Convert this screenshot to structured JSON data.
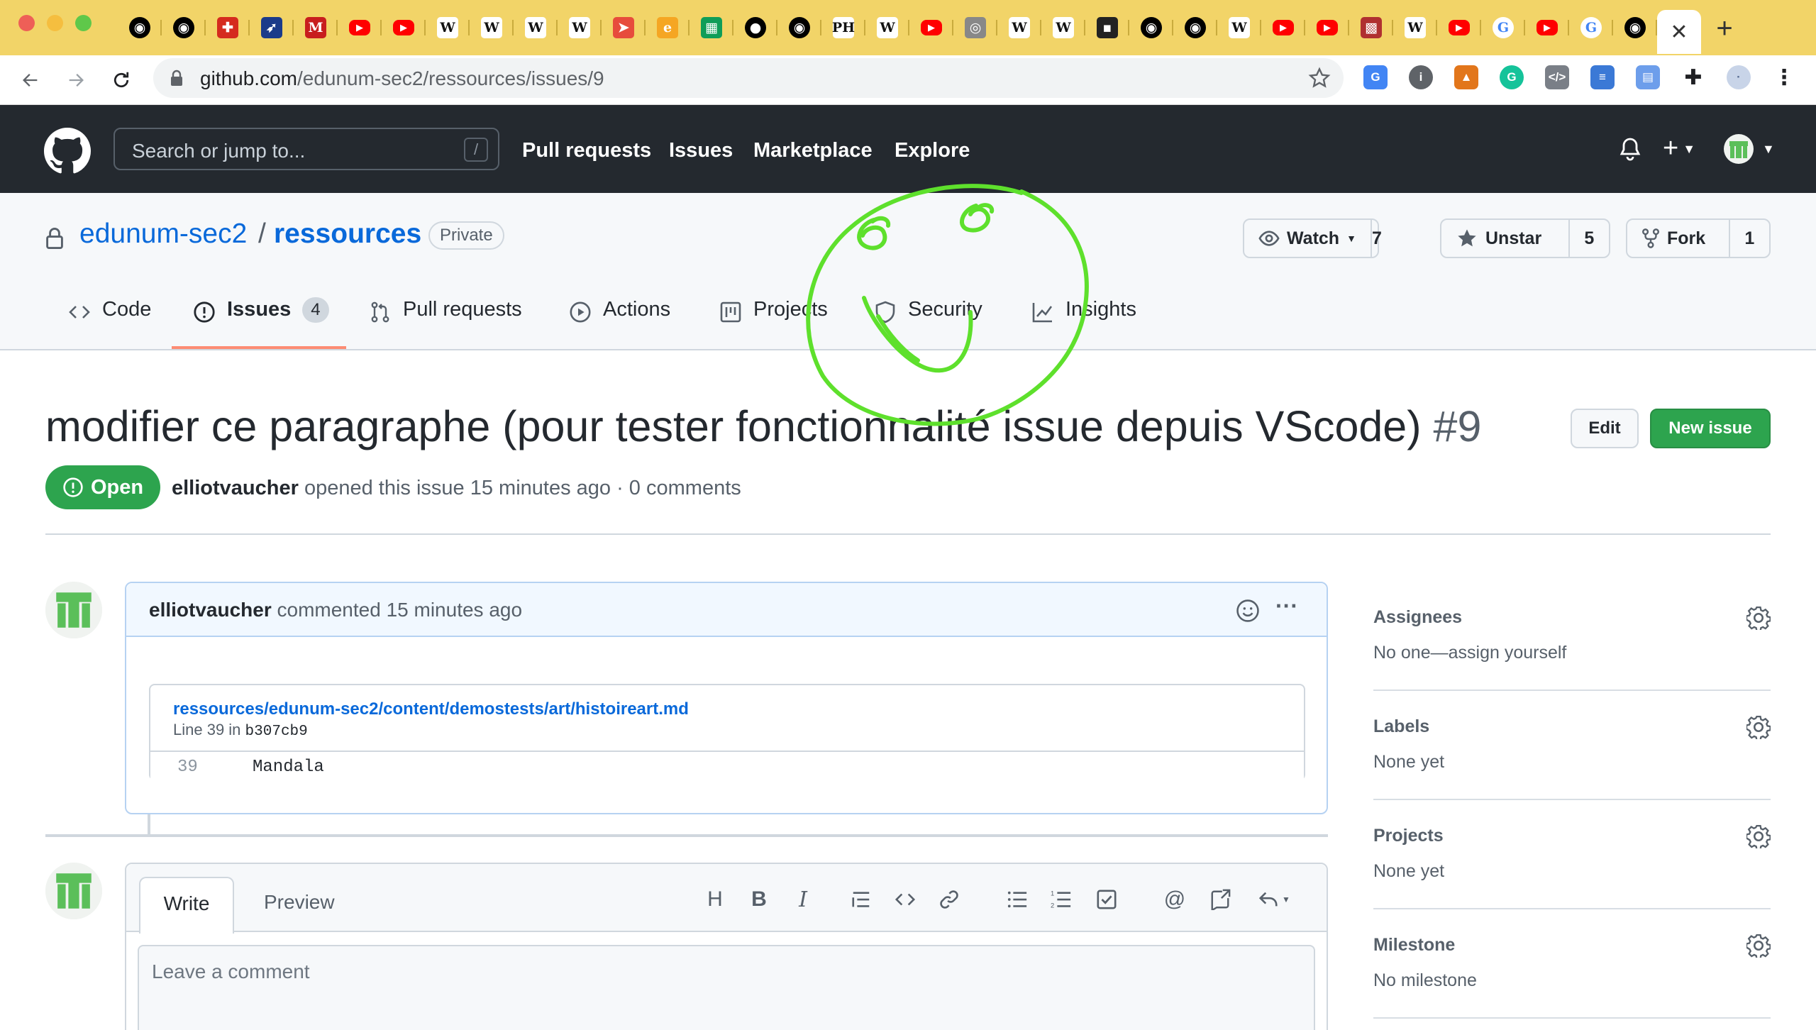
{
  "browser": {
    "url_host": "github.com",
    "url_path": "/edunum-sec2/ressources/issues/9",
    "tabs": [
      {
        "icon": "github-icon",
        "color": "#000"
      },
      {
        "icon": "github-icon",
        "color": "#000"
      },
      {
        "icon": "swiss-icon",
        "color": "#d52b1e"
      },
      {
        "icon": "plane-icon",
        "color": "#1b3b8a"
      },
      {
        "icon": "m-icon",
        "color": "#c81e1e"
      },
      {
        "icon": "youtube-icon",
        "color": "#ff0000"
      },
      {
        "icon": "youtube-icon",
        "color": "#ff0000"
      },
      {
        "icon": "wikipedia-icon",
        "color": "#fff"
      },
      {
        "icon": "wikipedia-icon",
        "color": "#fff"
      },
      {
        "icon": "wikipedia-icon",
        "color": "#fff"
      },
      {
        "icon": "wikipedia-icon",
        "color": "#fff"
      },
      {
        "icon": "arrow-icon",
        "color": "#e74c3c"
      },
      {
        "icon": "epfl-icon",
        "color": "#f5a623"
      },
      {
        "icon": "sheets-icon",
        "color": "#0f9d58"
      },
      {
        "icon": "dot-icon",
        "color": "#000"
      },
      {
        "icon": "github-icon",
        "color": "#000"
      },
      {
        "icon": "phzh-icon",
        "color": "#fff"
      },
      {
        "icon": "wikipedia-icon",
        "color": "#fff"
      },
      {
        "icon": "youtube-icon",
        "color": "#ff0000"
      },
      {
        "icon": "spiral-icon",
        "color": "#888"
      },
      {
        "icon": "wikipedia-icon",
        "color": "#fff"
      },
      {
        "icon": "wikipedia-icon",
        "color": "#fff"
      },
      {
        "icon": "terminal-icon",
        "color": "#222"
      },
      {
        "icon": "github-icon",
        "color": "#000"
      },
      {
        "icon": "github-icon",
        "color": "#000"
      },
      {
        "icon": "wikipedia-icon",
        "color": "#fff"
      },
      {
        "icon": "youtube-icon",
        "color": "#ff0000"
      },
      {
        "icon": "youtube-icon",
        "color": "#ff0000"
      },
      {
        "icon": "pattern-icon",
        "color": "#b03030"
      },
      {
        "icon": "wikipedia-icon",
        "color": "#fff"
      },
      {
        "icon": "youtube-icon",
        "color": "#ff0000"
      },
      {
        "icon": "google-icon",
        "color": "#fff"
      },
      {
        "icon": "youtube-icon",
        "color": "#ff0000"
      },
      {
        "icon": "google-icon",
        "color": "#fff"
      },
      {
        "icon": "github-icon",
        "color": "#000"
      }
    ]
  },
  "github": {
    "search_placeholder": "Search or jump to...",
    "search_shortcut": "/",
    "nav": [
      "Pull requests",
      "Issues",
      "Marketplace",
      "Explore"
    ]
  },
  "repo": {
    "owner": "edunum-sec2",
    "separator": "/",
    "name": "ressources",
    "visibility": "Private",
    "watch": {
      "label": "Watch",
      "count": "7"
    },
    "star": {
      "label": "Unstar",
      "count": "5"
    },
    "fork": {
      "label": "Fork",
      "count": "1"
    },
    "tabs": {
      "code": "Code",
      "issues": "Issues",
      "issues_count": "4",
      "pulls": "Pull requests",
      "actions": "Actions",
      "projects": "Projects",
      "security": "Security",
      "insights": "Insights"
    }
  },
  "issue": {
    "title": "modifier ce paragraphe (pour tester fonctionnalité issue depuis VScode)",
    "number": "#9",
    "edit_label": "Edit",
    "new_issue_label": "New issue",
    "state": "Open",
    "author": "elliotvaucher",
    "meta": "opened this issue 15 minutes ago · 0 comments"
  },
  "comment": {
    "author": "elliotvaucher",
    "time": "commented 15 minutes ago",
    "snippet_file": "ressources/edunum-sec2/content/demostests/art/histoireart.md",
    "snippet_line_prefix": "Line 39 in",
    "snippet_commit": "b307cb9",
    "line_number": "39",
    "line_text": "Mandala"
  },
  "editor": {
    "write_tab": "Write",
    "preview_tab": "Preview",
    "placeholder": "Leave a comment"
  },
  "sidebar": [
    {
      "heading": "Assignees",
      "value": "No one—assign yourself"
    },
    {
      "heading": "Labels",
      "value": "None yet"
    },
    {
      "heading": "Projects",
      "value": "None yet"
    },
    {
      "heading": "Milestone",
      "value": "No milestone"
    }
  ],
  "colors": {
    "browser_frame": "#f2d468",
    "github_header": "#24292f",
    "link": "#0969da",
    "open_green": "#2da44e",
    "annotation_green": "#5ee02c",
    "active_tab_underline": "#fd8c73"
  }
}
